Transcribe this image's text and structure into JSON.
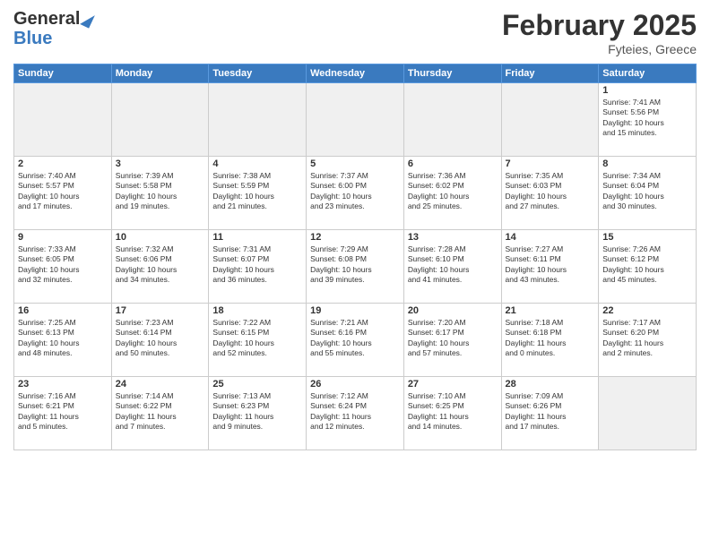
{
  "header": {
    "logo_general": "General",
    "logo_blue": "Blue",
    "month_title": "February 2025",
    "location": "Fyteies, Greece"
  },
  "days_of_week": [
    "Sunday",
    "Monday",
    "Tuesday",
    "Wednesday",
    "Thursday",
    "Friday",
    "Saturday"
  ],
  "weeks": [
    [
      {
        "day": "",
        "info": "",
        "empty": true
      },
      {
        "day": "",
        "info": "",
        "empty": true
      },
      {
        "day": "",
        "info": "",
        "empty": true
      },
      {
        "day": "",
        "info": "",
        "empty": true
      },
      {
        "day": "",
        "info": "",
        "empty": true
      },
      {
        "day": "",
        "info": "",
        "empty": true
      },
      {
        "day": "1",
        "info": "Sunrise: 7:41 AM\nSunset: 5:56 PM\nDaylight: 10 hours\nand 15 minutes."
      }
    ],
    [
      {
        "day": "2",
        "info": "Sunrise: 7:40 AM\nSunset: 5:57 PM\nDaylight: 10 hours\nand 17 minutes."
      },
      {
        "day": "3",
        "info": "Sunrise: 7:39 AM\nSunset: 5:58 PM\nDaylight: 10 hours\nand 19 minutes."
      },
      {
        "day": "4",
        "info": "Sunrise: 7:38 AM\nSunset: 5:59 PM\nDaylight: 10 hours\nand 21 minutes."
      },
      {
        "day": "5",
        "info": "Sunrise: 7:37 AM\nSunset: 6:00 PM\nDaylight: 10 hours\nand 23 minutes."
      },
      {
        "day": "6",
        "info": "Sunrise: 7:36 AM\nSunset: 6:02 PM\nDaylight: 10 hours\nand 25 minutes."
      },
      {
        "day": "7",
        "info": "Sunrise: 7:35 AM\nSunset: 6:03 PM\nDaylight: 10 hours\nand 27 minutes."
      },
      {
        "day": "8",
        "info": "Sunrise: 7:34 AM\nSunset: 6:04 PM\nDaylight: 10 hours\nand 30 minutes."
      }
    ],
    [
      {
        "day": "9",
        "info": "Sunrise: 7:33 AM\nSunset: 6:05 PM\nDaylight: 10 hours\nand 32 minutes."
      },
      {
        "day": "10",
        "info": "Sunrise: 7:32 AM\nSunset: 6:06 PM\nDaylight: 10 hours\nand 34 minutes."
      },
      {
        "day": "11",
        "info": "Sunrise: 7:31 AM\nSunset: 6:07 PM\nDaylight: 10 hours\nand 36 minutes."
      },
      {
        "day": "12",
        "info": "Sunrise: 7:29 AM\nSunset: 6:08 PM\nDaylight: 10 hours\nand 39 minutes."
      },
      {
        "day": "13",
        "info": "Sunrise: 7:28 AM\nSunset: 6:10 PM\nDaylight: 10 hours\nand 41 minutes."
      },
      {
        "day": "14",
        "info": "Sunrise: 7:27 AM\nSunset: 6:11 PM\nDaylight: 10 hours\nand 43 minutes."
      },
      {
        "day": "15",
        "info": "Sunrise: 7:26 AM\nSunset: 6:12 PM\nDaylight: 10 hours\nand 45 minutes."
      }
    ],
    [
      {
        "day": "16",
        "info": "Sunrise: 7:25 AM\nSunset: 6:13 PM\nDaylight: 10 hours\nand 48 minutes."
      },
      {
        "day": "17",
        "info": "Sunrise: 7:23 AM\nSunset: 6:14 PM\nDaylight: 10 hours\nand 50 minutes."
      },
      {
        "day": "18",
        "info": "Sunrise: 7:22 AM\nSunset: 6:15 PM\nDaylight: 10 hours\nand 52 minutes."
      },
      {
        "day": "19",
        "info": "Sunrise: 7:21 AM\nSunset: 6:16 PM\nDaylight: 10 hours\nand 55 minutes."
      },
      {
        "day": "20",
        "info": "Sunrise: 7:20 AM\nSunset: 6:17 PM\nDaylight: 10 hours\nand 57 minutes."
      },
      {
        "day": "21",
        "info": "Sunrise: 7:18 AM\nSunset: 6:18 PM\nDaylight: 11 hours\nand 0 minutes."
      },
      {
        "day": "22",
        "info": "Sunrise: 7:17 AM\nSunset: 6:20 PM\nDaylight: 11 hours\nand 2 minutes."
      }
    ],
    [
      {
        "day": "23",
        "info": "Sunrise: 7:16 AM\nSunset: 6:21 PM\nDaylight: 11 hours\nand 5 minutes."
      },
      {
        "day": "24",
        "info": "Sunrise: 7:14 AM\nSunset: 6:22 PM\nDaylight: 11 hours\nand 7 minutes."
      },
      {
        "day": "25",
        "info": "Sunrise: 7:13 AM\nSunset: 6:23 PM\nDaylight: 11 hours\nand 9 minutes."
      },
      {
        "day": "26",
        "info": "Sunrise: 7:12 AM\nSunset: 6:24 PM\nDaylight: 11 hours\nand 12 minutes."
      },
      {
        "day": "27",
        "info": "Sunrise: 7:10 AM\nSunset: 6:25 PM\nDaylight: 11 hours\nand 14 minutes."
      },
      {
        "day": "28",
        "info": "Sunrise: 7:09 AM\nSunset: 6:26 PM\nDaylight: 11 hours\nand 17 minutes."
      },
      {
        "day": "",
        "info": "",
        "empty": true
      }
    ]
  ]
}
